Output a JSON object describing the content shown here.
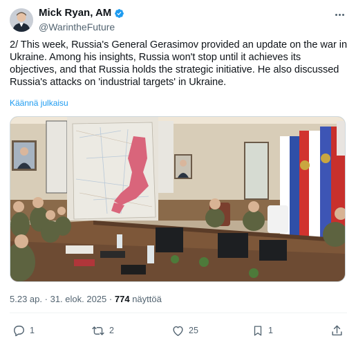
{
  "author": {
    "display_name": "Mick Ryan, AM",
    "handle": "@WarintheFuture",
    "verified": true
  },
  "icons": {
    "verified": "verified-badge-icon",
    "more": "more-dots-icon",
    "reply": "reply-icon",
    "retweet": "retweet-icon",
    "like": "like-icon",
    "bookmark": "bookmark-icon",
    "share": "share-icon"
  },
  "colors": {
    "accent": "#1d9bf0",
    "text": "#0f1419",
    "muted": "#536471"
  },
  "tweet": {
    "text": "2/ This week, Russia's General Gerasimov provided an update on the war in Ukraine. Among his insights, Russia won't stop until it achieves its objectives, and that Russia holds the strategic initiative. He also discussed Russia's attacks on 'industrial targets' in Ukraine.",
    "translate_label": "Käännä julkaisu"
  },
  "meta": {
    "time": "5.23 ap.",
    "separator": "·",
    "date": "31. elok. 2025",
    "views_count": "774",
    "views_label": "näyttöä"
  },
  "actions": {
    "replies": "1",
    "retweets": "2",
    "likes": "25",
    "bookmarks": "1"
  }
}
